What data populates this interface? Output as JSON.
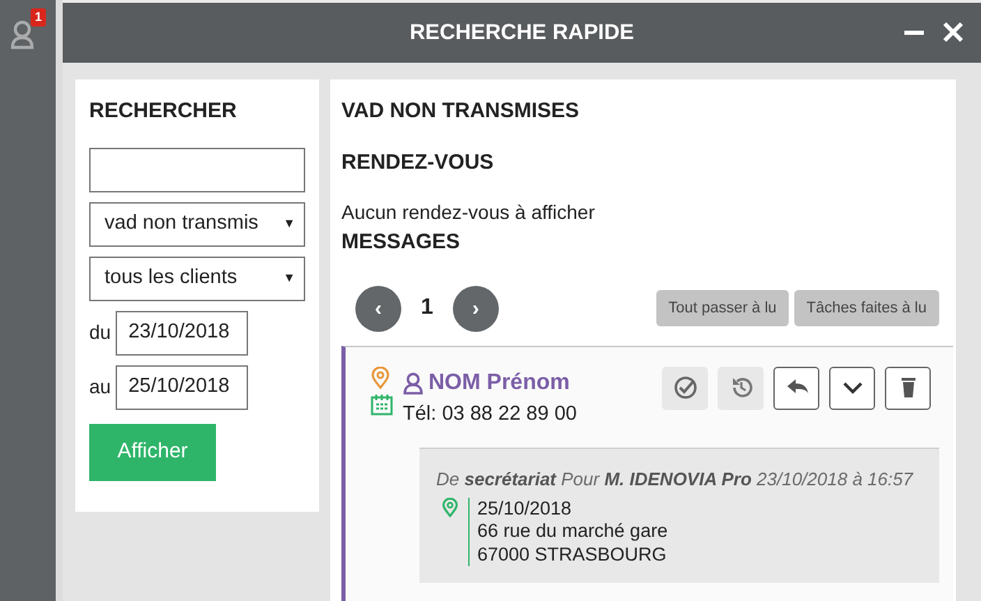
{
  "sidebar": {
    "badge": "1"
  },
  "window": {
    "title": "RECHERCHE RAPIDE"
  },
  "search": {
    "heading": "RECHERCHER",
    "filters": [
      {
        "value": "vad non transmis",
        "caret": "▼"
      },
      {
        "value": "tous les clients",
        "caret": "▼"
      }
    ],
    "dates": [
      {
        "label": "du",
        "value": "23/10/2018"
      },
      {
        "label": "au",
        "value": "25/10/2018"
      }
    ],
    "submit": "Afficher"
  },
  "results": {
    "heading": "VAD NON TRANSMISES",
    "appointments": {
      "heading": "RENDEZ-VOUS",
      "empty_text": "Aucun rendez-vous à afficher"
    },
    "messages": {
      "heading": "MESSAGES",
      "pager": {
        "prev": "‹",
        "page": "1",
        "next": "›"
      },
      "bulk_actions": [
        "Tout passer à lu",
        "Tâches faites à lu"
      ],
      "items": [
        {
          "name": "NOM Prénom",
          "phone": "Tél: 03 88 22 89 00",
          "actions": [
            {
              "kind": "check",
              "filled": true
            },
            {
              "kind": "history",
              "filled": true
            },
            {
              "kind": "reply",
              "filled": false
            },
            {
              "kind": "expand",
              "filled": false
            },
            {
              "kind": "delete",
              "filled": false
            }
          ],
          "meta": "De  **secrétariat** Pour  **M. IDENOVIA Pro**  23/10/2018 à 16:57",
          "details": [
            "25/10/2018",
            "66 rue du marché gare",
            "67000 STRASBOURG"
          ]
        }
      ]
    }
  }
}
